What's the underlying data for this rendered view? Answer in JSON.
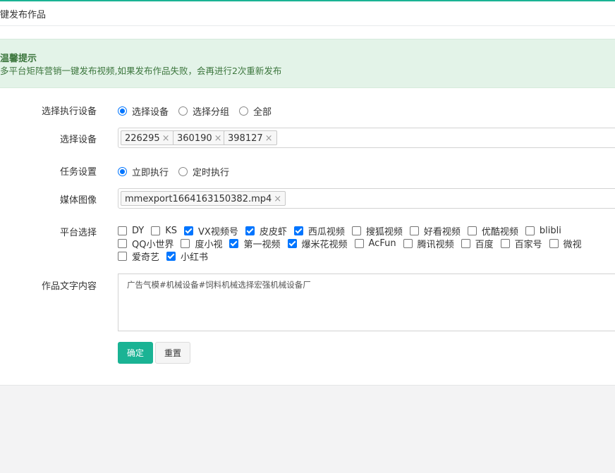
{
  "page": {
    "title": "键发布作品"
  },
  "alert": {
    "title": "温馨提示",
    "text": "多平台矩阵营销一键发布视频,如果发布作品失败，会再进行2次重新发布"
  },
  "form": {
    "exec_device": {
      "label": "选择执行设备",
      "options": [
        {
          "label": "选择设备",
          "checked": true
        },
        {
          "label": "选择分组",
          "checked": false
        },
        {
          "label": "全部",
          "checked": false
        }
      ]
    },
    "device_select": {
      "label": "选择设备",
      "tags": [
        "226295",
        "360190",
        "398127"
      ],
      "remove_glyph": "×"
    },
    "task": {
      "label": "任务设置",
      "options": [
        {
          "label": "立即执行",
          "checked": true
        },
        {
          "label": "定时执行",
          "checked": false
        }
      ]
    },
    "media": {
      "label": "媒体图像",
      "tags": [
        "mmexport1664163150382.mp4"
      ]
    },
    "platforms": {
      "label": "平台选择",
      "rows": [
        [
          {
            "label": "DY",
            "checked": false
          },
          {
            "label": "KS",
            "checked": false
          },
          {
            "label": "VX视频号",
            "checked": true
          },
          {
            "label": "皮皮虾",
            "checked": true
          },
          {
            "label": "西瓜视频",
            "checked": true
          },
          {
            "label": "搜狐视频",
            "checked": false
          },
          {
            "label": "好看视频",
            "checked": false
          },
          {
            "label": "优酷视频",
            "checked": false
          },
          {
            "label": "blibli",
            "checked": false
          }
        ],
        [
          {
            "label": "QQ小世界",
            "checked": false
          },
          {
            "label": "度小视",
            "checked": false
          },
          {
            "label": "第一视频",
            "checked": true
          },
          {
            "label": "爆米花视频",
            "checked": true
          },
          {
            "label": "AcFun",
            "checked": false
          },
          {
            "label": "腾讯视频",
            "checked": false
          },
          {
            "label": "百度",
            "checked": false
          },
          {
            "label": "百家号",
            "checked": false
          },
          {
            "label": "微视",
            "checked": false
          }
        ],
        [
          {
            "label": "爱奇艺",
            "checked": false
          },
          {
            "label": "小红书",
            "checked": true
          }
        ]
      ]
    },
    "content": {
      "label": "作品文字内容",
      "value": "广告气模#机械设备#饲料机械选择宏强机械设备厂"
    },
    "buttons": {
      "confirm": "确定",
      "reset": "重置"
    }
  },
  "colors": {
    "accent": "#1ab394",
    "checkbox": "#0075ff",
    "alert_bg": "#e3f3e8",
    "alert_text": "#3c763d"
  }
}
